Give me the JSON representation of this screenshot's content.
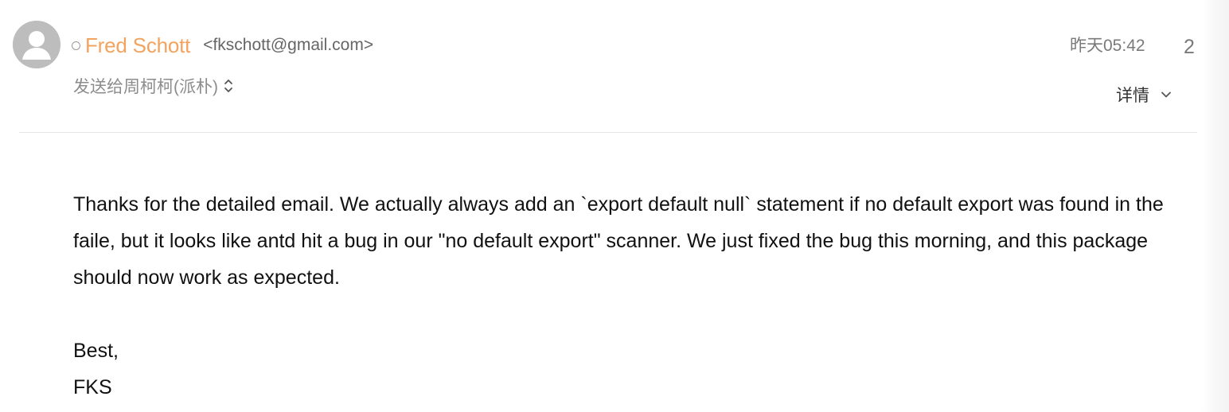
{
  "header": {
    "sender_name": "Fred Schott",
    "sender_email": "<fkschott@gmail.com>",
    "recipients": "发送给周柯柯(派朴)",
    "timestamp": "昨天05:42",
    "count": "2",
    "details_label": "详情"
  },
  "icons": {
    "avatar": "person-avatar-icon",
    "status": "status-dot-icon",
    "recipients_toggle": "chevron-updown-icon",
    "details_toggle": "chevron-down-icon"
  },
  "colors": {
    "sender_name": "#f2a45e",
    "avatar_bg": "#bdbdbd",
    "muted_text": "#8c8c8c",
    "divider": "#e8e8e8"
  },
  "body": {
    "paragraph_1": "Thanks for the detailed email. We actually always add an `export default null` statement if no default export was found in the faile, but it looks like antd hit a bug in our \"no default export\" scanner. We just fixed the bug this morning, and this package should now work as expected.",
    "closing": "Best,",
    "signature": "FKS"
  }
}
